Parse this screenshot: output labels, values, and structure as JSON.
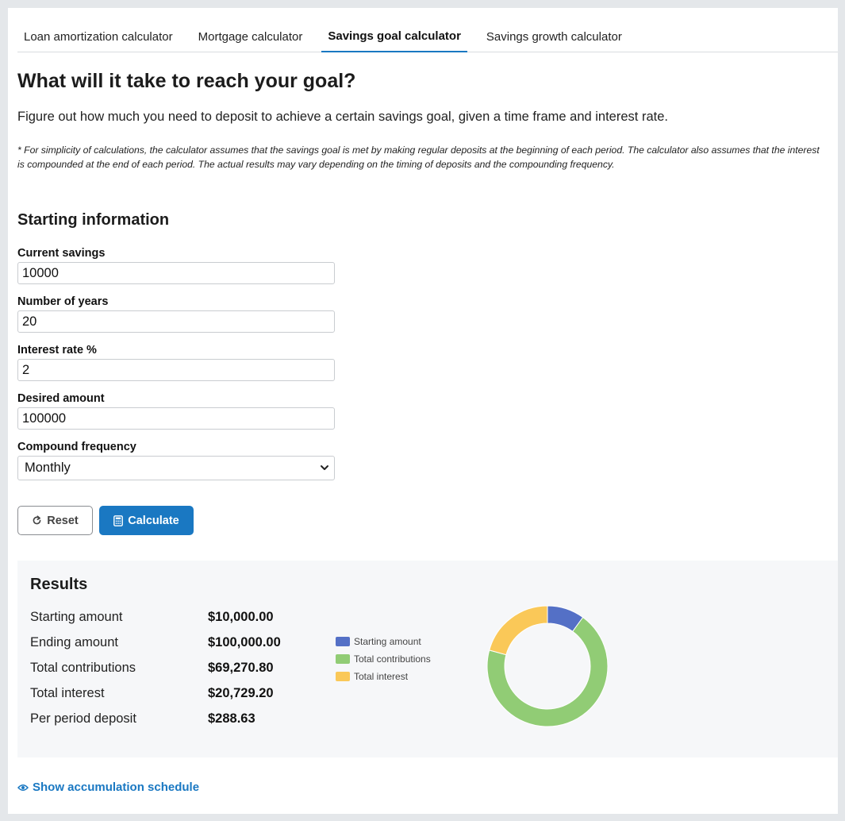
{
  "tabs": [
    {
      "label": "Loan amortization calculator",
      "active": false
    },
    {
      "label": "Mortgage calculator",
      "active": false
    },
    {
      "label": "Savings goal calculator",
      "active": true
    },
    {
      "label": "Savings growth calculator",
      "active": false
    }
  ],
  "page": {
    "title": "What will it take to reach your goal?",
    "intro": "Figure out how much you need to deposit to achieve a certain savings goal, given a time frame and interest rate.",
    "note": "* For simplicity of calculations, the calculator assumes that the savings goal is met by making regular deposits at the beginning of each period. The calculator also assumes that the interest is compounded at the end of each period. The actual results may vary depending on the timing of deposits and the compounding frequency."
  },
  "form": {
    "section_title": "Starting information",
    "current_savings": {
      "label": "Current savings",
      "value": "10000"
    },
    "years": {
      "label": "Number of years",
      "value": "20"
    },
    "rate": {
      "label": "Interest rate %",
      "value": "2"
    },
    "desired": {
      "label": "Desired amount",
      "value": "100000"
    },
    "frequency": {
      "label": "Compound frequency",
      "value": "Monthly"
    }
  },
  "buttons": {
    "reset": "Reset",
    "calculate": "Calculate"
  },
  "results": {
    "title": "Results",
    "rows": [
      {
        "label": "Starting amount",
        "value": "$10,000.00"
      },
      {
        "label": "Ending amount",
        "value": "$100,000.00"
      },
      {
        "label": "Total contributions",
        "value": "$69,270.80"
      },
      {
        "label": "Total interest",
        "value": "$20,729.20"
      },
      {
        "label": "Per period deposit",
        "value": "$288.63"
      }
    ]
  },
  "chart_data": {
    "type": "pie",
    "donut": true,
    "legend_position": "left",
    "series": [
      {
        "name": "Starting amount",
        "value": 10000,
        "color": "#5470c6"
      },
      {
        "name": "Total contributions",
        "value": 69270.8,
        "color": "#91cc75"
      },
      {
        "name": "Total interest",
        "value": 20729.2,
        "color": "#fac858"
      }
    ]
  },
  "links": {
    "schedule": "Show accumulation schedule"
  },
  "colors": {
    "accent": "#1a78c2",
    "results_bg": "#f6f7f9"
  }
}
